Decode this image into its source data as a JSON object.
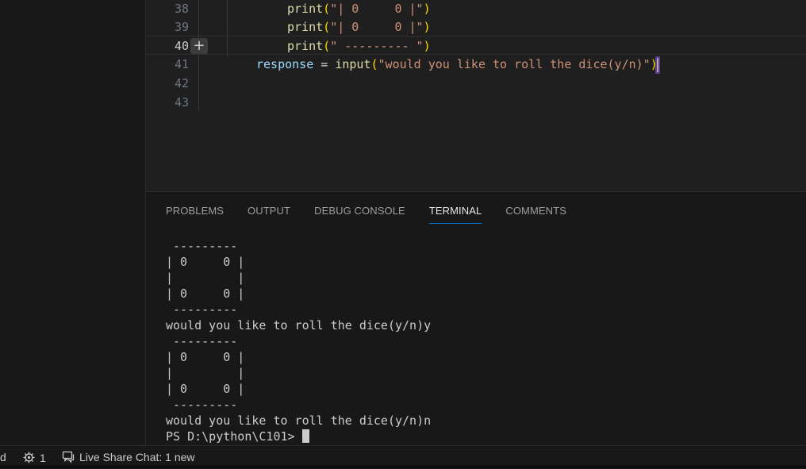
{
  "editor": {
    "lines": [
      {
        "number": "38",
        "code_fn": "print",
        "code_open": "(",
        "code_str": "\"| 0     0 |\"",
        "code_close": ")"
      },
      {
        "number": "39",
        "code_fn": "print",
        "code_open": "(",
        "code_str": "\"| 0     0 |\"",
        "code_close": ")"
      },
      {
        "number": "40",
        "code_fn": "print",
        "code_open": "(",
        "code_str": "\" --------- \"",
        "code_close": ")"
      },
      {
        "number": "41",
        "var": "response",
        "op": " = ",
        "code_fn": "input",
        "code_open": "(",
        "code_str": "\"would you like to roll the dice(y/n)\"",
        "code_close": ")"
      },
      {
        "number": "42"
      },
      {
        "number": "43"
      }
    ],
    "add_button_label": "+"
  },
  "panel": {
    "tabs": [
      {
        "label": "PROBLEMS"
      },
      {
        "label": "OUTPUT"
      },
      {
        "label": "DEBUG CONSOLE"
      },
      {
        "label": "TERMINAL"
      },
      {
        "label": "COMMENTS"
      }
    ],
    "active_tab": "TERMINAL",
    "terminal_lines": [
      " ---------",
      "| 0     0 |",
      "|         |",
      "| 0     0 |",
      " ---------",
      "would you like to roll the dice(y/n)y",
      " ---------",
      "| 0     0 |",
      "|         |",
      "| 0     0 |",
      " ---------",
      "would you like to roll the dice(y/n)n"
    ],
    "prompt": "PS D:\\python\\C101> "
  },
  "statusbar": {
    "left_fragment": "d",
    "ports_count": "1",
    "live_share_chat": "Live Share Chat: 1 new"
  },
  "colors": {
    "accent": "#0078d4",
    "function": "#dcdcaa",
    "string": "#ce9178",
    "bracket": "#ffd700"
  }
}
